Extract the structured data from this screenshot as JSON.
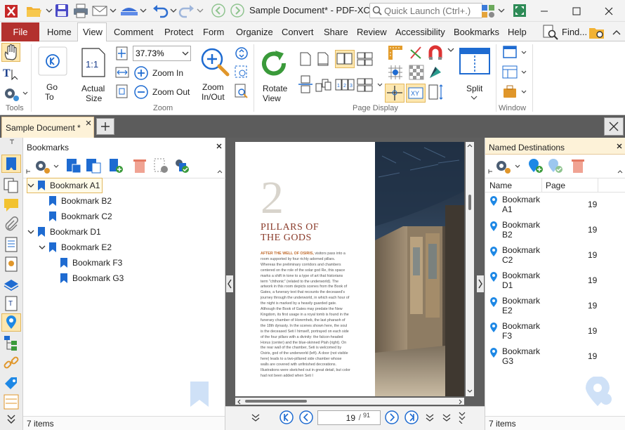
{
  "app": {
    "title": "Sample Document* - PDF-XCh...",
    "search_placeholder": "Quick Launch (Ctrl+.)"
  },
  "menu": {
    "file": "File",
    "items": [
      "Home",
      "View",
      "Comment",
      "Protect",
      "Form",
      "Organize",
      "Convert",
      "Share",
      "Review",
      "Accessibility",
      "Bookmarks",
      "Help"
    ],
    "active": "View",
    "find": "Find..."
  },
  "ribbon": {
    "go_to": "Go",
    "go_to_2": "To",
    "actual_size": "Actual",
    "actual_size_2": "Size",
    "zoom_value": "37.73%",
    "zoom_in": "Zoom In",
    "zoom_out": "Zoom Out",
    "zoom_inout": "Zoom",
    "zoom_inout_2": "In/Out",
    "rotate": "Rotate",
    "rotate_2": "View",
    "split": "Split",
    "groups": {
      "tools": "Tools",
      "zoom": "Zoom",
      "page_display": "Page Display",
      "window": "Window"
    }
  },
  "doc_tab": {
    "label": "Sample Document *"
  },
  "bookmarks": {
    "title": "Bookmarks",
    "items": [
      {
        "label": "Bookmark A1",
        "level": 0,
        "expanded": true,
        "selected": true
      },
      {
        "label": "Bookmark B2",
        "level": 1
      },
      {
        "label": "Bookmark C2",
        "level": 1
      },
      {
        "label": "Bookmark D1",
        "level": 0,
        "expanded": true
      },
      {
        "label": "Bookmark E2",
        "level": 1,
        "expanded": true
      },
      {
        "label": "Bookmark F3",
        "level": 2
      },
      {
        "label": "Bookmark G3",
        "level": 2
      }
    ],
    "status": "7 items"
  },
  "page": {
    "chapter_number": "2",
    "heading_1": "PILLARS OF",
    "heading_2": "THE GODS",
    "lead": "AFTER THE WELL OF OSIRIS,",
    "body": "visitors pass into a room supported by four richly adorned pillars. Whereas the preliminary corridors and chambers centered on the role of the solar god Re, this space marks a shift in tone to a type of art that historians term \"chthonic\" (related to the underworld). The artwork in this room depicts scenes from the Book of Gates, a funerary text that recounts the deceased's journey through the underworld, in which each hour of the night is marked by a heavily guarded gate. Although the Book of Gates may predate the New Kingdom, its first usage in a royal tomb is found in the funerary chamber of Horemheb, the last pharaoh of the 18th dynasty. In the scenes shown here, the soul is the deceased Seti I himself, portrayed on each side of the four pillars with a divinity: the falcon-headed Horus (center) and the blue-skinned Ptah (right). On the rear wall of the chamber, Seti is welcomed by Osiris, god of the underworld (left). A door (not visible here) leads to a two-pillared side chamber whose walls are covered with unfinished decorations. Illustrations were sketched out in great detail, but color had not been added when Seti I"
  },
  "navigation": {
    "current_page": "19",
    "total_pages": "91"
  },
  "named_destinations": {
    "title": "Named Destinations",
    "columns": [
      "Name",
      "Page"
    ],
    "rows": [
      {
        "name": "Bookmark A1",
        "page": "19"
      },
      {
        "name": "Bookmark B2",
        "page": "19"
      },
      {
        "name": "Bookmark C2",
        "page": "19"
      },
      {
        "name": "Bookmark D1",
        "page": "19"
      },
      {
        "name": "Bookmark E2",
        "page": "19"
      },
      {
        "name": "Bookmark F3",
        "page": "19"
      },
      {
        "name": "Bookmark G3",
        "page": "19"
      }
    ],
    "status": "7 items"
  },
  "colors": {
    "file_tab": "#b3312e",
    "accent_blue": "#1e88e5",
    "tab_active": "#fdf2d8",
    "tool_highlight": "#fde7b0"
  }
}
